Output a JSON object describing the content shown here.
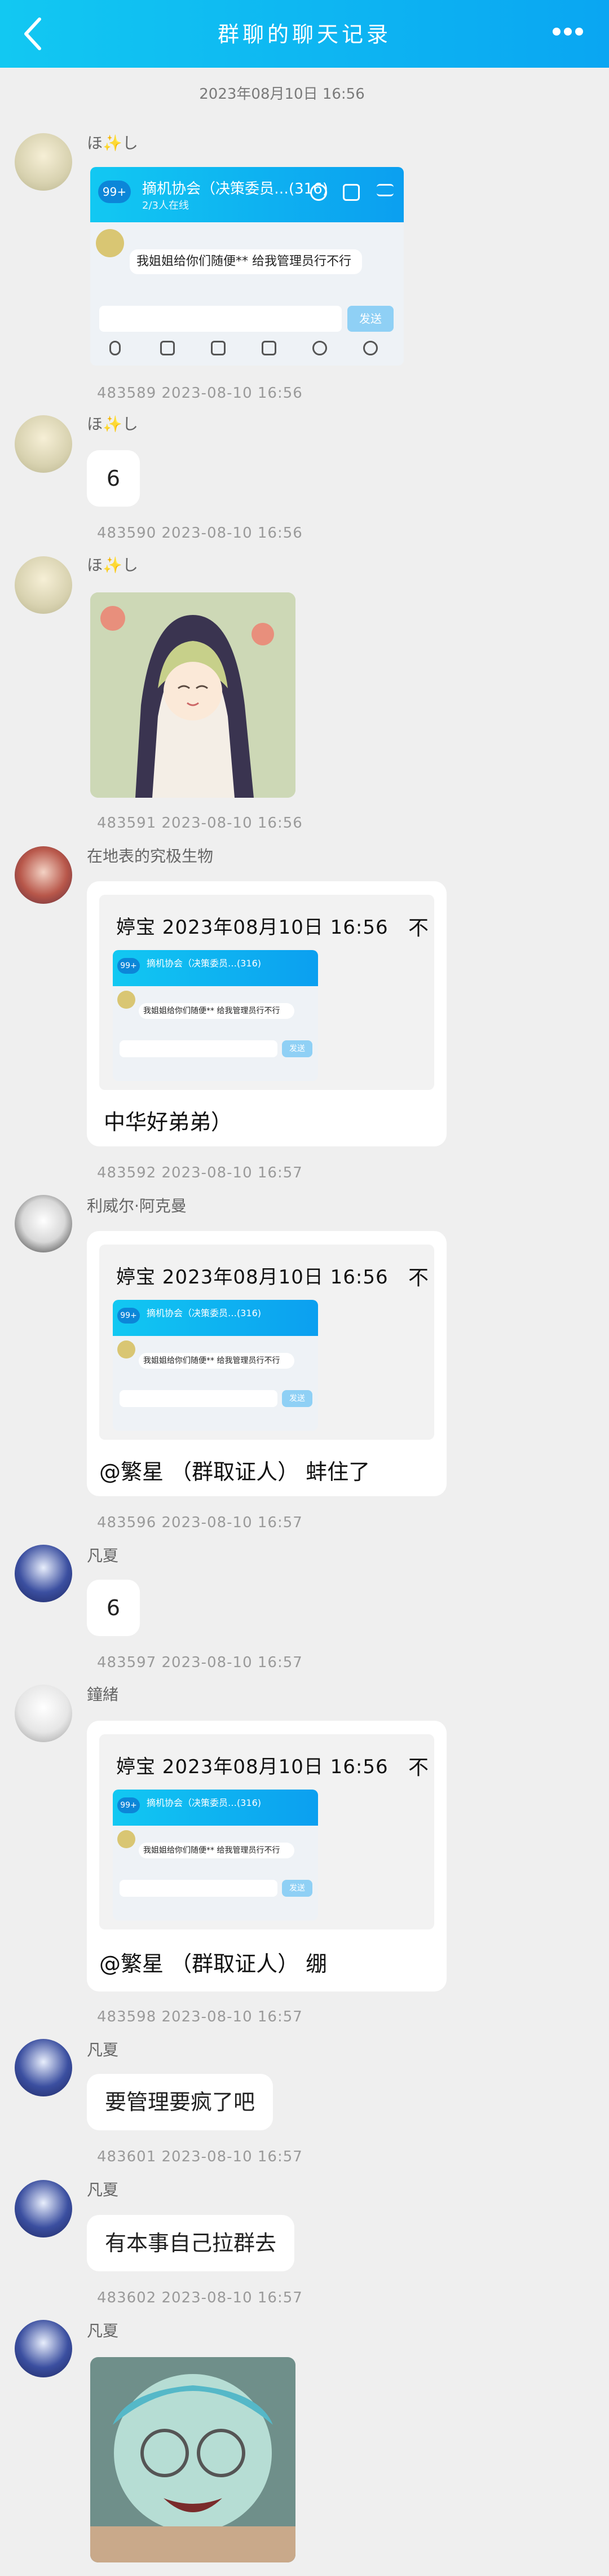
{
  "header": {
    "title": "群聊的聊天记录",
    "back_icon": "chevron-left-icon",
    "more_icon": "more-dots-icon"
  },
  "date_divider": "2023年08月10日 16:56",
  "screenshot_preview": {
    "group_title": "摘机协会（决策委员…(316)",
    "unread": "99+",
    "subtitle": "2/3人在线",
    "message": "我姐姐给你们随便** 给我管理员行不行",
    "send_label": "发送"
  },
  "messages": [
    {
      "sender": "ほ✨し",
      "type": "screenshot",
      "meta": "483589  2023-08-10 16:56"
    },
    {
      "sender": "ほ✨し",
      "type": "text",
      "text": "6",
      "meta": "483590  2023-08-10 16:56"
    },
    {
      "sender": "ほ✨し",
      "type": "sticker",
      "meta": "483591  2023-08-10 16:56"
    },
    {
      "sender": "在地表的究极生物",
      "type": "quote",
      "quote_header": "婷宝 2023年08月10日 16:56",
      "quote_cut": "不",
      "text": "中华好弟弟）",
      "meta": "483592  2023-08-10 16:57"
    },
    {
      "sender": "利威尔·阿克曼",
      "type": "quote",
      "quote_header": "婷宝 2023年08月10日 16:56",
      "quote_cut": "不",
      "text": "@繁星 （群取证人） 蚌住了",
      "meta": "483596  2023-08-10 16:57"
    },
    {
      "sender": "凡夏",
      "type": "text",
      "text": "6",
      "meta": "483597  2023-08-10 16:57"
    },
    {
      "sender": "鐘緒",
      "type": "quote",
      "quote_header": "婷宝 2023年08月10日 16:56",
      "quote_cut": "不",
      "text": "@繁星 （群取证人） 绷",
      "meta": "483598  2023-08-10 16:57"
    },
    {
      "sender": "凡夏",
      "type": "text",
      "text": "要管理要疯了吧",
      "meta": "483601  2023-08-10 16:57"
    },
    {
      "sender": "凡夏",
      "type": "text",
      "text": "有本事自己拉群去",
      "meta": "483602  2023-08-10 16:57"
    },
    {
      "sender": "凡夏",
      "type": "sticker"
    }
  ]
}
